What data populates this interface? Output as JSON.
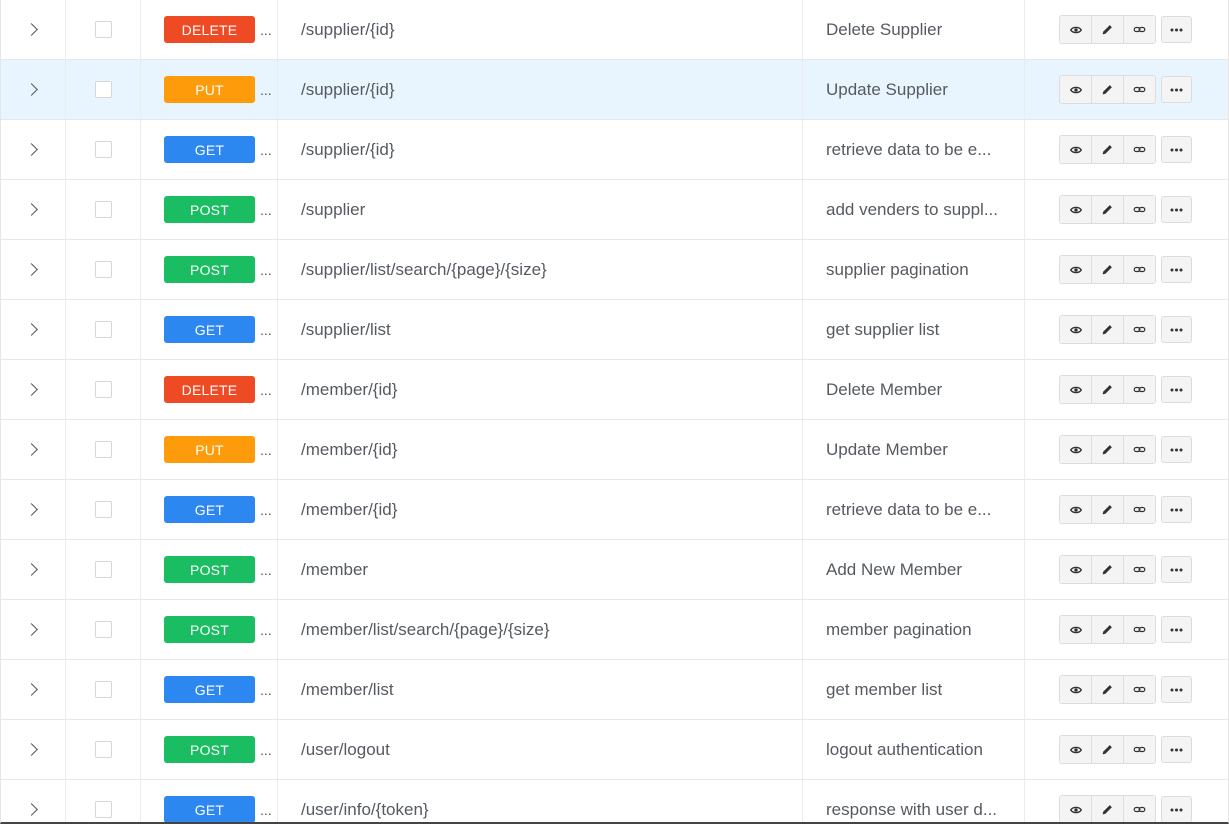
{
  "colors": {
    "DELETE": "#ee4a24",
    "PUT": "#fe9b0b",
    "GET": "#2d87f0",
    "POST": "#1bbd63"
  },
  "highlighted_row": 1,
  "rows": [
    {
      "method": "DELETE",
      "path": "/supplier/{id}",
      "description": "Delete Supplier"
    },
    {
      "method": "PUT",
      "path": "/supplier/{id}",
      "description": "Update Supplier"
    },
    {
      "method": "GET",
      "path": "/supplier/{id}",
      "description": "retrieve data to be e..."
    },
    {
      "method": "POST",
      "path": "/supplier",
      "description": "add venders to suppl..."
    },
    {
      "method": "POST",
      "path": "/supplier/list/search/{page}/{size}",
      "description": "supplier pagination"
    },
    {
      "method": "GET",
      "path": "/supplier/list",
      "description": "get supplier list"
    },
    {
      "method": "DELETE",
      "path": "/member/{id}",
      "description": "Delete Member"
    },
    {
      "method": "PUT",
      "path": "/member/{id}",
      "description": "Update Member"
    },
    {
      "method": "GET",
      "path": "/member/{id}",
      "description": "retrieve data to be e..."
    },
    {
      "method": "POST",
      "path": "/member",
      "description": "Add New Member"
    },
    {
      "method": "POST",
      "path": "/member/list/search/{page}/{size}",
      "description": "member pagination"
    },
    {
      "method": "GET",
      "path": "/member/list",
      "description": "get member list"
    },
    {
      "method": "POST",
      "path": "/user/logout",
      "description": "logout authentication"
    },
    {
      "method": "GET",
      "path": "/user/info/{token}",
      "description": "response with user d..."
    }
  ],
  "ellipsis": "...",
  "icons": {
    "expand": "chevron-right-icon",
    "view": "eye-icon",
    "edit": "pencil-icon",
    "link": "link-icon",
    "more": "more-horizontal-icon"
  }
}
